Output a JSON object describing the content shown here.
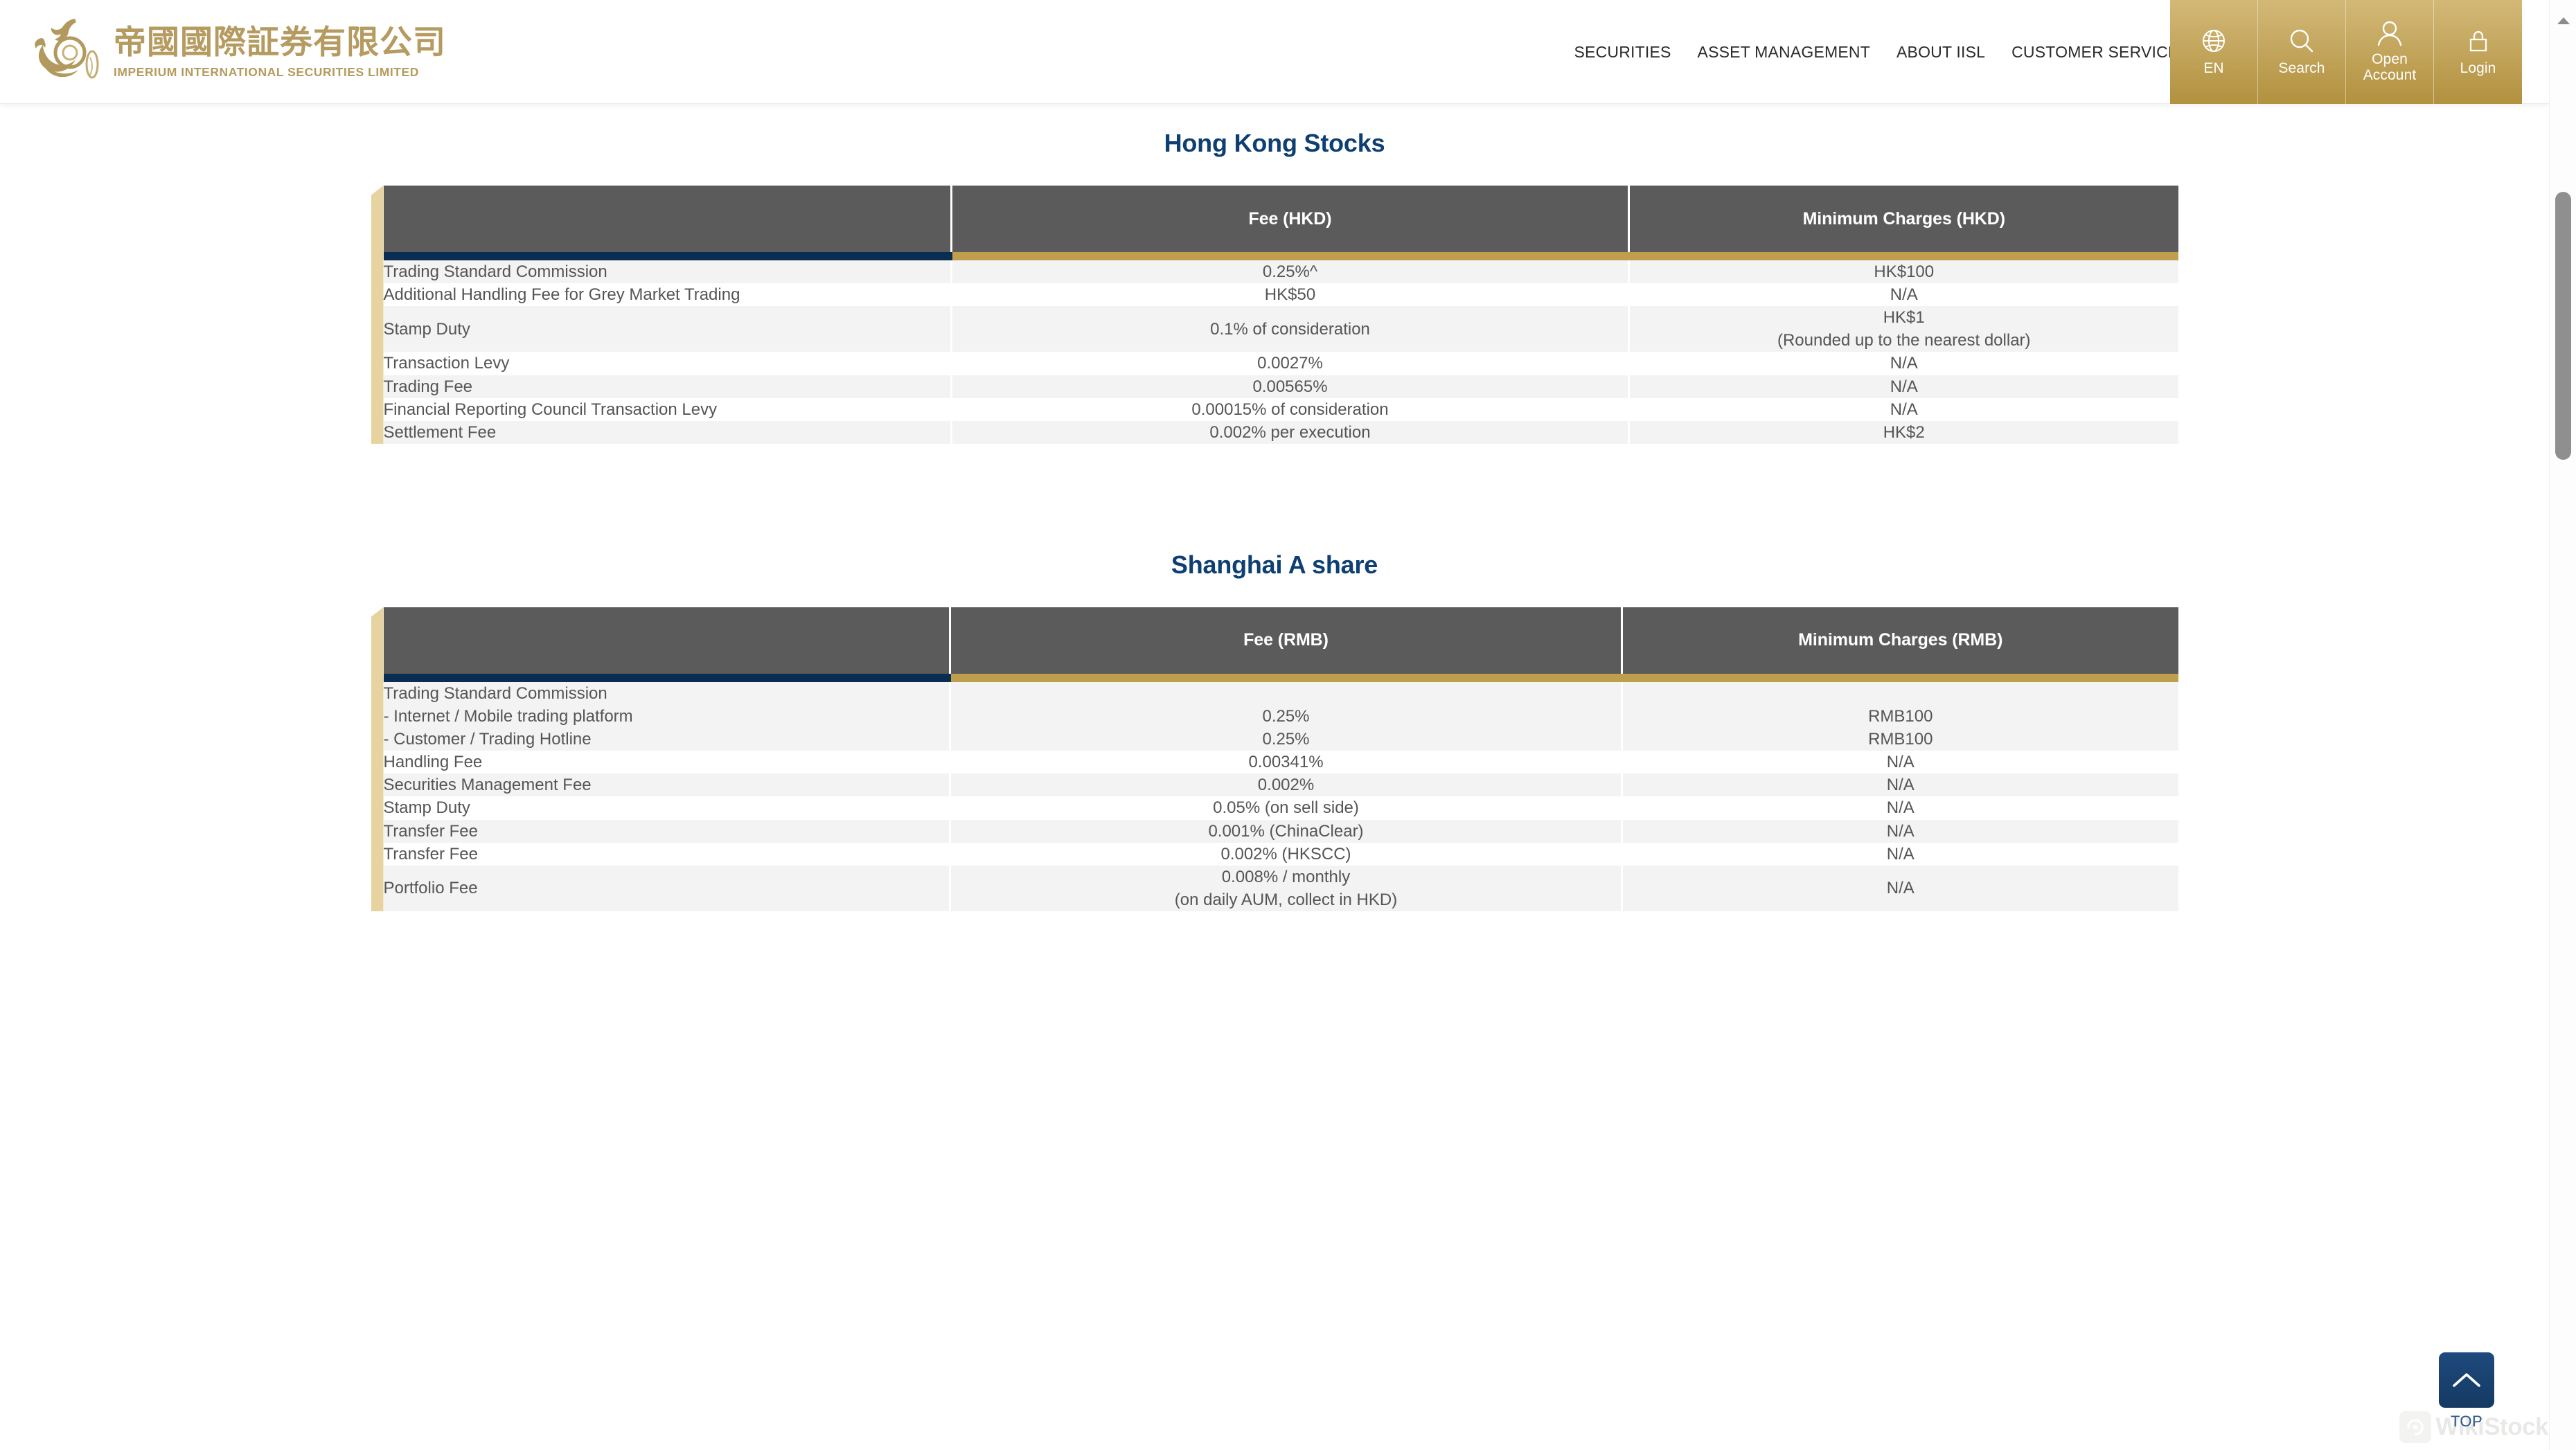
{
  "header": {
    "logo": {
      "chinese_name": "帝國國際証券有限公司",
      "english_name": "IMPERIUM INTERNATIONAL SECURITIES LIMITED",
      "icon": "dragon-emblem-icon"
    },
    "nav": [
      {
        "label": "SECURITIES"
      },
      {
        "label": "ASSET MANAGEMENT"
      },
      {
        "label": "ABOUT IISL"
      },
      {
        "label": "CUSTOMER SERVICES"
      }
    ],
    "utilities": [
      {
        "label": "EN",
        "icon": "globe-icon"
      },
      {
        "label": "Search",
        "icon": "search-icon"
      },
      {
        "label": "Open Account",
        "label_line1": "Open",
        "label_line2": "Account",
        "icon": "user-icon"
      },
      {
        "label": "Login",
        "icon": "lock-icon"
      }
    ]
  },
  "colors": {
    "gold": "#c5a860",
    "gold_light": "#e7d3a0",
    "gold_rule": "#bf9f4e",
    "navy": "#0d3f72",
    "navy_rule": "#0a2d52",
    "header_gray": "#5b5b5b",
    "row_stripe": "#f3f3f3",
    "text_gray": "#555555"
  },
  "sections": [
    {
      "title": "Hong Kong Stocks",
      "columns": [
        "",
        "Fee (HKD)",
        "Minimum Charges (HKD)"
      ],
      "rows": [
        {
          "label": [
            "Trading Standard Commission"
          ],
          "fee": [
            "0.25%^"
          ],
          "min": [
            "HK$100"
          ]
        },
        {
          "label": [
            "Additional Handling Fee for Grey Market Trading"
          ],
          "fee": [
            "HK$50"
          ],
          "min": [
            "N/A"
          ]
        },
        {
          "label": [
            "Stamp Duty"
          ],
          "fee": [
            "0.1% of consideration"
          ],
          "min": [
            "HK$1",
            "(Rounded up to the nearest dollar)"
          ]
        },
        {
          "label": [
            "Transaction Levy"
          ],
          "fee": [
            "0.0027%"
          ],
          "min": [
            "N/A"
          ]
        },
        {
          "label": [
            "Trading Fee"
          ],
          "fee": [
            "0.00565%"
          ],
          "min": [
            "N/A"
          ]
        },
        {
          "label": [
            "Financial Reporting Council Transaction Levy"
          ],
          "fee": [
            "0.00015% of consideration"
          ],
          "min": [
            "N/A"
          ]
        },
        {
          "label": [
            "Settlement Fee"
          ],
          "fee": [
            "0.002% per execution"
          ],
          "min": [
            "HK$2"
          ]
        }
      ]
    },
    {
      "title": "Shanghai A share",
      "columns": [
        "",
        "Fee (RMB)",
        "Minimum Charges (RMB)"
      ],
      "rows": [
        {
          "label": [
            "Trading Standard Commission",
            "- Internet / Mobile trading platform",
            "- Customer / Trading Hotline"
          ],
          "fee": [
            "",
            "0.25%",
            "0.25%"
          ],
          "min": [
            "",
            "RMB100",
            "RMB100"
          ]
        },
        {
          "label": [
            "Handling Fee"
          ],
          "fee": [
            "0.00341%"
          ],
          "min": [
            "N/A"
          ]
        },
        {
          "label": [
            "Securities Management Fee"
          ],
          "fee": [
            "0.002%"
          ],
          "min": [
            "N/A"
          ]
        },
        {
          "label": [
            "Stamp Duty"
          ],
          "fee": [
            "0.05% (on sell side)"
          ],
          "min": [
            "N/A"
          ]
        },
        {
          "label": [
            "Transfer Fee"
          ],
          "fee": [
            "0.001% (ChinaClear)"
          ],
          "min": [
            "N/A"
          ]
        },
        {
          "label": [
            "Transfer Fee"
          ],
          "fee": [
            "0.002% (HKSCC)"
          ],
          "min": [
            "N/A"
          ]
        },
        {
          "label": [
            "Portfolio Fee"
          ],
          "fee": [
            "0.008% / monthly",
            "(on daily AUM, collect in HKD)"
          ],
          "min": [
            "N/A"
          ]
        }
      ]
    }
  ],
  "scroll_top_button": {
    "label": "TOP",
    "icon": "chevron-up-icon"
  },
  "watermark": {
    "text": "WikiStock",
    "icon": "wikistock-logo-icon"
  },
  "scrollbar": {
    "arrow_icon": "scroll-up-arrow-icon"
  }
}
